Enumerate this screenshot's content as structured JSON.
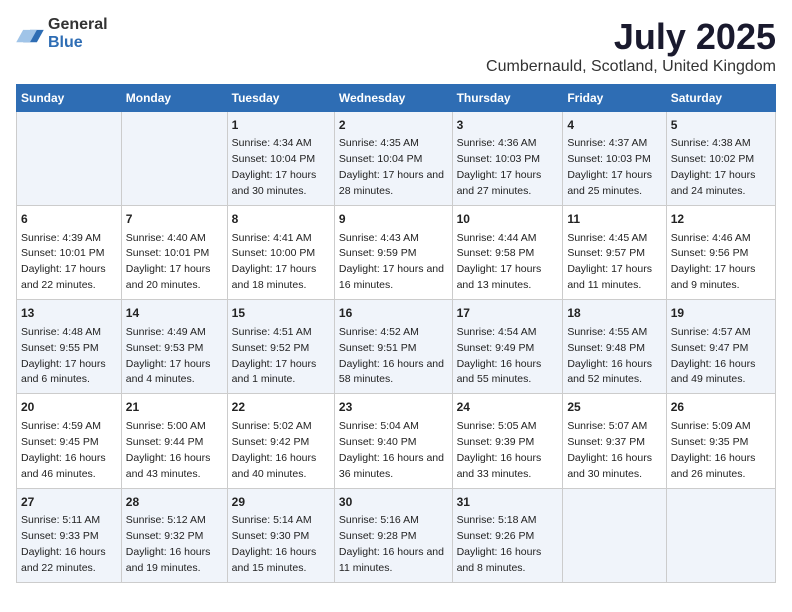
{
  "logo": {
    "general": "General",
    "blue": "Blue"
  },
  "header": {
    "month": "July 2025",
    "location": "Cumbernauld, Scotland, United Kingdom"
  },
  "weekdays": [
    "Sunday",
    "Monday",
    "Tuesday",
    "Wednesday",
    "Thursday",
    "Friday",
    "Saturday"
  ],
  "weeks": [
    [
      {
        "day": "",
        "info": ""
      },
      {
        "day": "",
        "info": ""
      },
      {
        "day": "1",
        "info": "Sunrise: 4:34 AM\nSunset: 10:04 PM\nDaylight: 17 hours and 30 minutes."
      },
      {
        "day": "2",
        "info": "Sunrise: 4:35 AM\nSunset: 10:04 PM\nDaylight: 17 hours and 28 minutes."
      },
      {
        "day": "3",
        "info": "Sunrise: 4:36 AM\nSunset: 10:03 PM\nDaylight: 17 hours and 27 minutes."
      },
      {
        "day": "4",
        "info": "Sunrise: 4:37 AM\nSunset: 10:03 PM\nDaylight: 17 hours and 25 minutes."
      },
      {
        "day": "5",
        "info": "Sunrise: 4:38 AM\nSunset: 10:02 PM\nDaylight: 17 hours and 24 minutes."
      }
    ],
    [
      {
        "day": "6",
        "info": "Sunrise: 4:39 AM\nSunset: 10:01 PM\nDaylight: 17 hours and 22 minutes."
      },
      {
        "day": "7",
        "info": "Sunrise: 4:40 AM\nSunset: 10:01 PM\nDaylight: 17 hours and 20 minutes."
      },
      {
        "day": "8",
        "info": "Sunrise: 4:41 AM\nSunset: 10:00 PM\nDaylight: 17 hours and 18 minutes."
      },
      {
        "day": "9",
        "info": "Sunrise: 4:43 AM\nSunset: 9:59 PM\nDaylight: 17 hours and 16 minutes."
      },
      {
        "day": "10",
        "info": "Sunrise: 4:44 AM\nSunset: 9:58 PM\nDaylight: 17 hours and 13 minutes."
      },
      {
        "day": "11",
        "info": "Sunrise: 4:45 AM\nSunset: 9:57 PM\nDaylight: 17 hours and 11 minutes."
      },
      {
        "day": "12",
        "info": "Sunrise: 4:46 AM\nSunset: 9:56 PM\nDaylight: 17 hours and 9 minutes."
      }
    ],
    [
      {
        "day": "13",
        "info": "Sunrise: 4:48 AM\nSunset: 9:55 PM\nDaylight: 17 hours and 6 minutes."
      },
      {
        "day": "14",
        "info": "Sunrise: 4:49 AM\nSunset: 9:53 PM\nDaylight: 17 hours and 4 minutes."
      },
      {
        "day": "15",
        "info": "Sunrise: 4:51 AM\nSunset: 9:52 PM\nDaylight: 17 hours and 1 minute."
      },
      {
        "day": "16",
        "info": "Sunrise: 4:52 AM\nSunset: 9:51 PM\nDaylight: 16 hours and 58 minutes."
      },
      {
        "day": "17",
        "info": "Sunrise: 4:54 AM\nSunset: 9:49 PM\nDaylight: 16 hours and 55 minutes."
      },
      {
        "day": "18",
        "info": "Sunrise: 4:55 AM\nSunset: 9:48 PM\nDaylight: 16 hours and 52 minutes."
      },
      {
        "day": "19",
        "info": "Sunrise: 4:57 AM\nSunset: 9:47 PM\nDaylight: 16 hours and 49 minutes."
      }
    ],
    [
      {
        "day": "20",
        "info": "Sunrise: 4:59 AM\nSunset: 9:45 PM\nDaylight: 16 hours and 46 minutes."
      },
      {
        "day": "21",
        "info": "Sunrise: 5:00 AM\nSunset: 9:44 PM\nDaylight: 16 hours and 43 minutes."
      },
      {
        "day": "22",
        "info": "Sunrise: 5:02 AM\nSunset: 9:42 PM\nDaylight: 16 hours and 40 minutes."
      },
      {
        "day": "23",
        "info": "Sunrise: 5:04 AM\nSunset: 9:40 PM\nDaylight: 16 hours and 36 minutes."
      },
      {
        "day": "24",
        "info": "Sunrise: 5:05 AM\nSunset: 9:39 PM\nDaylight: 16 hours and 33 minutes."
      },
      {
        "day": "25",
        "info": "Sunrise: 5:07 AM\nSunset: 9:37 PM\nDaylight: 16 hours and 30 minutes."
      },
      {
        "day": "26",
        "info": "Sunrise: 5:09 AM\nSunset: 9:35 PM\nDaylight: 16 hours and 26 minutes."
      }
    ],
    [
      {
        "day": "27",
        "info": "Sunrise: 5:11 AM\nSunset: 9:33 PM\nDaylight: 16 hours and 22 minutes."
      },
      {
        "day": "28",
        "info": "Sunrise: 5:12 AM\nSunset: 9:32 PM\nDaylight: 16 hours and 19 minutes."
      },
      {
        "day": "29",
        "info": "Sunrise: 5:14 AM\nSunset: 9:30 PM\nDaylight: 16 hours and 15 minutes."
      },
      {
        "day": "30",
        "info": "Sunrise: 5:16 AM\nSunset: 9:28 PM\nDaylight: 16 hours and 11 minutes."
      },
      {
        "day": "31",
        "info": "Sunrise: 5:18 AM\nSunset: 9:26 PM\nDaylight: 16 hours and 8 minutes."
      },
      {
        "day": "",
        "info": ""
      },
      {
        "day": "",
        "info": ""
      }
    ]
  ]
}
